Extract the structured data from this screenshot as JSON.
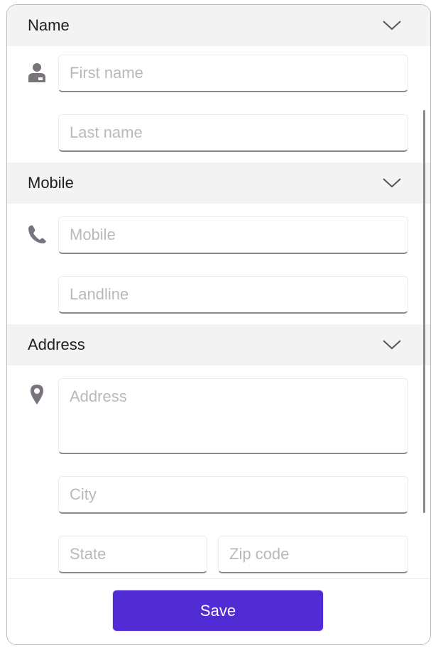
{
  "form": {
    "sections": [
      {
        "title": "Name",
        "icon": "person-icon",
        "expanded": true,
        "fields": [
          {
            "placeholder": "First name",
            "value": ""
          },
          {
            "placeholder": "Last name",
            "value": ""
          }
        ]
      },
      {
        "title": "Mobile",
        "icon": "phone-icon",
        "expanded": true,
        "fields": [
          {
            "placeholder": "Mobile",
            "value": ""
          },
          {
            "placeholder": "Landline",
            "value": ""
          }
        ]
      },
      {
        "title": "Address",
        "icon": "location-pin-icon",
        "expanded": true,
        "fields": [
          {
            "placeholder": "Address",
            "value": ""
          },
          {
            "placeholder": "City",
            "value": ""
          },
          {
            "placeholder": "State",
            "value": ""
          },
          {
            "placeholder": "Zip code",
            "value": ""
          }
        ]
      }
    ],
    "save_label": "Save"
  },
  "colors": {
    "accent": "#512bd4",
    "header_bg": "#f3f3f3",
    "icon": "#78737c",
    "placeholder": "#b9b9b9"
  }
}
